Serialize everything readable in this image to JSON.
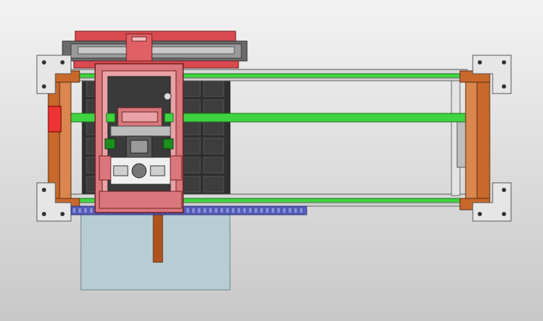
{
  "viewport": {
    "background_top": "#f4f4f4",
    "background_bottom": "#c6c6c6"
  },
  "colors": {
    "red_frame": "#d9777c",
    "red_dark": "#b8474d",
    "red_top": "#d84a4f",
    "orange_bracket": "#c8682b",
    "green_rail": "#3fd43f",
    "green_dark": "#1e8f1e",
    "silver_rail": "#d8d8d8",
    "dark_grey": "#4a4a4a",
    "mid_grey": "#8a8a8a",
    "blue_cable": "#5a63c9",
    "glass_panel": "#b7cdd3",
    "wood_post": "#b0541d",
    "spoilboard": "#3a3a3a",
    "white_plate": "#f0f0f0"
  },
  "parts": {
    "gantry": "gantry-carriage",
    "spoilboard": "spoilboard-bed",
    "rails": [
      "upper-y-rail",
      "center-x-rail",
      "lower-y-rail"
    ],
    "brackets": [
      "left-top-bracket",
      "left-bottom-bracket",
      "right-top-bracket",
      "right-bottom-bracket"
    ]
  }
}
